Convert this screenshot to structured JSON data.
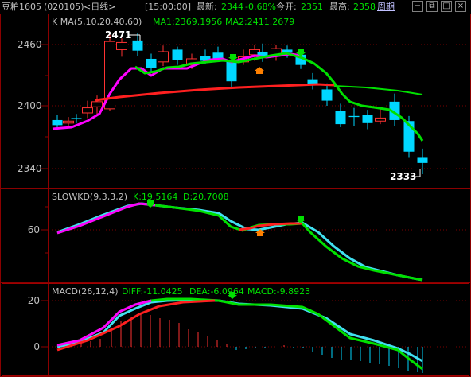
{
  "header": {
    "symbol": "豆粕1605",
    "code": "(020105)",
    "period": "<日线>",
    "time": "[15:00:00]",
    "latest_label": "最新:",
    "latest_value": "2344",
    "change_pct": "-0.68%",
    "open_label": "今开:",
    "open_value": "2351",
    "high_label": "最高:",
    "high_value": "2358",
    "cycle_link": "周期"
  },
  "main_panel": {
    "ma_legend": "K  MA(5,10,20,40,60)",
    "ma1": "MA1:2369.1956",
    "ma2": "MA2:2411.2679",
    "y_ticks": [
      "2460",
      "2400",
      "2340"
    ],
    "high_annot": "2471",
    "low_annot": "2333"
  },
  "kd_panel": {
    "legend": "SLOWKD(9,3,3,2)",
    "k": "K:19.5164",
    "d": "D:20.7008",
    "y_ticks": [
      "60"
    ]
  },
  "macd_panel": {
    "legend": "MACD(26,12,4)",
    "diff": "DIFF:-11.0425",
    "dea": "DEA:-6.0964",
    "macd": "MACD:-9.8923",
    "y_ticks": [
      "20",
      "0"
    ]
  },
  "colors": {
    "up": "#ff3232",
    "down": "#00d7ff",
    "ma_magenta": "#ff00ff",
    "ma_green": "#00e000",
    "ma_red": "#ff2020",
    "grid_red": "#8b0000",
    "cyan_line": "#40e0f0"
  }
}
